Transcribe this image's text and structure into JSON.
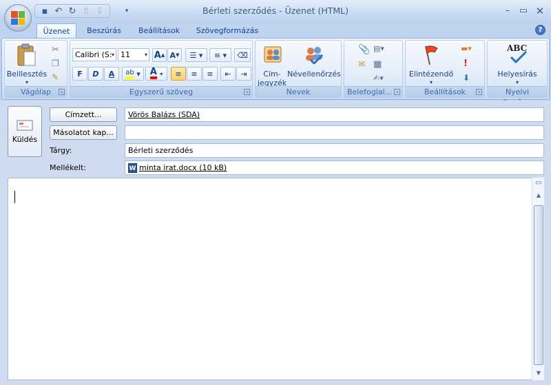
{
  "window": {
    "title": "Bérleti szerződés - Üzenet (HTML)"
  },
  "qat": {
    "icons": [
      "save-icon",
      "undo-icon",
      "redo-icon",
      "previous-icon",
      "next-icon",
      "customize-icon"
    ]
  },
  "tabs": [
    "Üzenet",
    "Beszúrás",
    "Beállítások",
    "Szövegformázás"
  ],
  "ribbon": {
    "clipboard": {
      "paste": "Beillesztés",
      "group": "Vágólap"
    },
    "basic_text": {
      "font": "Calibri (S:",
      "size": "11",
      "bold": "F",
      "italic": "D",
      "underline": "A",
      "group": "Egyszerű szöveg"
    },
    "names": {
      "address_book_line1": "Cím-",
      "address_book_line2": "jegyzék",
      "check_names": "Névellenőrzés",
      "group": "Nevek"
    },
    "include": {
      "group": "Belefoglal..."
    },
    "options": {
      "follow_up": "Elintézendő",
      "group": "Beállítások"
    },
    "proofing": {
      "spelling_icon": "ABC",
      "spelling": "Helyesírás",
      "group": "Nyelvi ellenőrz..."
    }
  },
  "compose": {
    "send": "Küldés",
    "to_button": "Címzett...",
    "cc_button": "Másolatot kap...",
    "to_value": "Vörös Balázs (SDA)",
    "cc_value": "",
    "subject_label": "Tárgy:",
    "subject_value": "Bérleti szerződés",
    "attached_label": "Mellékelt:",
    "attachment": "minta irat.docx (10 kB)"
  },
  "colors": {
    "accent": "#15428b",
    "highlight": "#ffff00",
    "font_color": "#ff0000",
    "flag": "#e8462a"
  }
}
